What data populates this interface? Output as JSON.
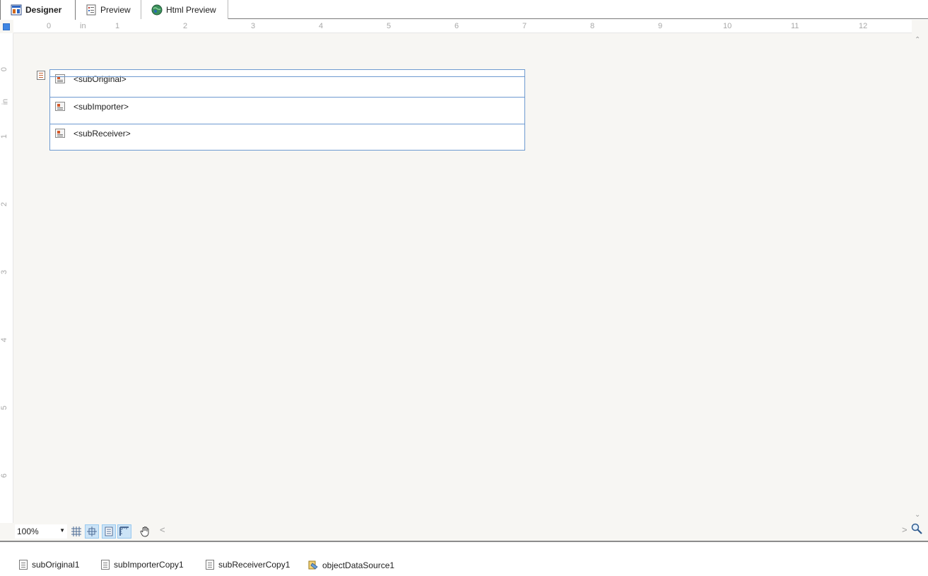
{
  "tabs": [
    {
      "label": "Designer",
      "icon": "designer-icon",
      "active": true
    },
    {
      "label": "Preview",
      "icon": "preview-icon",
      "active": false
    },
    {
      "label": "Html Preview",
      "icon": "globe-icon",
      "active": false
    }
  ],
  "ruler": {
    "horizontal_ticks": [
      "0",
      "in",
      "1",
      "2",
      "3",
      "4",
      "5",
      "6",
      "7",
      "8",
      "9",
      "10",
      "11",
      "12"
    ],
    "vertical_ticks": [
      "0",
      "in",
      "1",
      "2",
      "3",
      "4",
      "5",
      "6"
    ]
  },
  "report": {
    "subreports": [
      {
        "label": "<subOriginal>"
      },
      {
        "label": "<subImporter>"
      },
      {
        "label": "<subReceiver>"
      }
    ]
  },
  "toolbar": {
    "zoom": "100%",
    "buttons": [
      "grid-icon",
      "snap-icon",
      "page-icon",
      "ruler-icon",
      "hand-icon"
    ],
    "zoom_tool": "magnifier-icon"
  },
  "tray": {
    "items": [
      {
        "label": "subOriginal1",
        "icon": "report-icon"
      },
      {
        "label": "subImporterCopy1",
        "icon": "report-icon"
      },
      {
        "label": "subReceiverCopy1",
        "icon": "report-icon"
      },
      {
        "label": "objectDataSource1",
        "icon": "datasource-icon"
      }
    ]
  },
  "colors": {
    "canvas": "#f7f6f3",
    "band_border": "#6e9ad0",
    "accent": "#3f86e3"
  }
}
